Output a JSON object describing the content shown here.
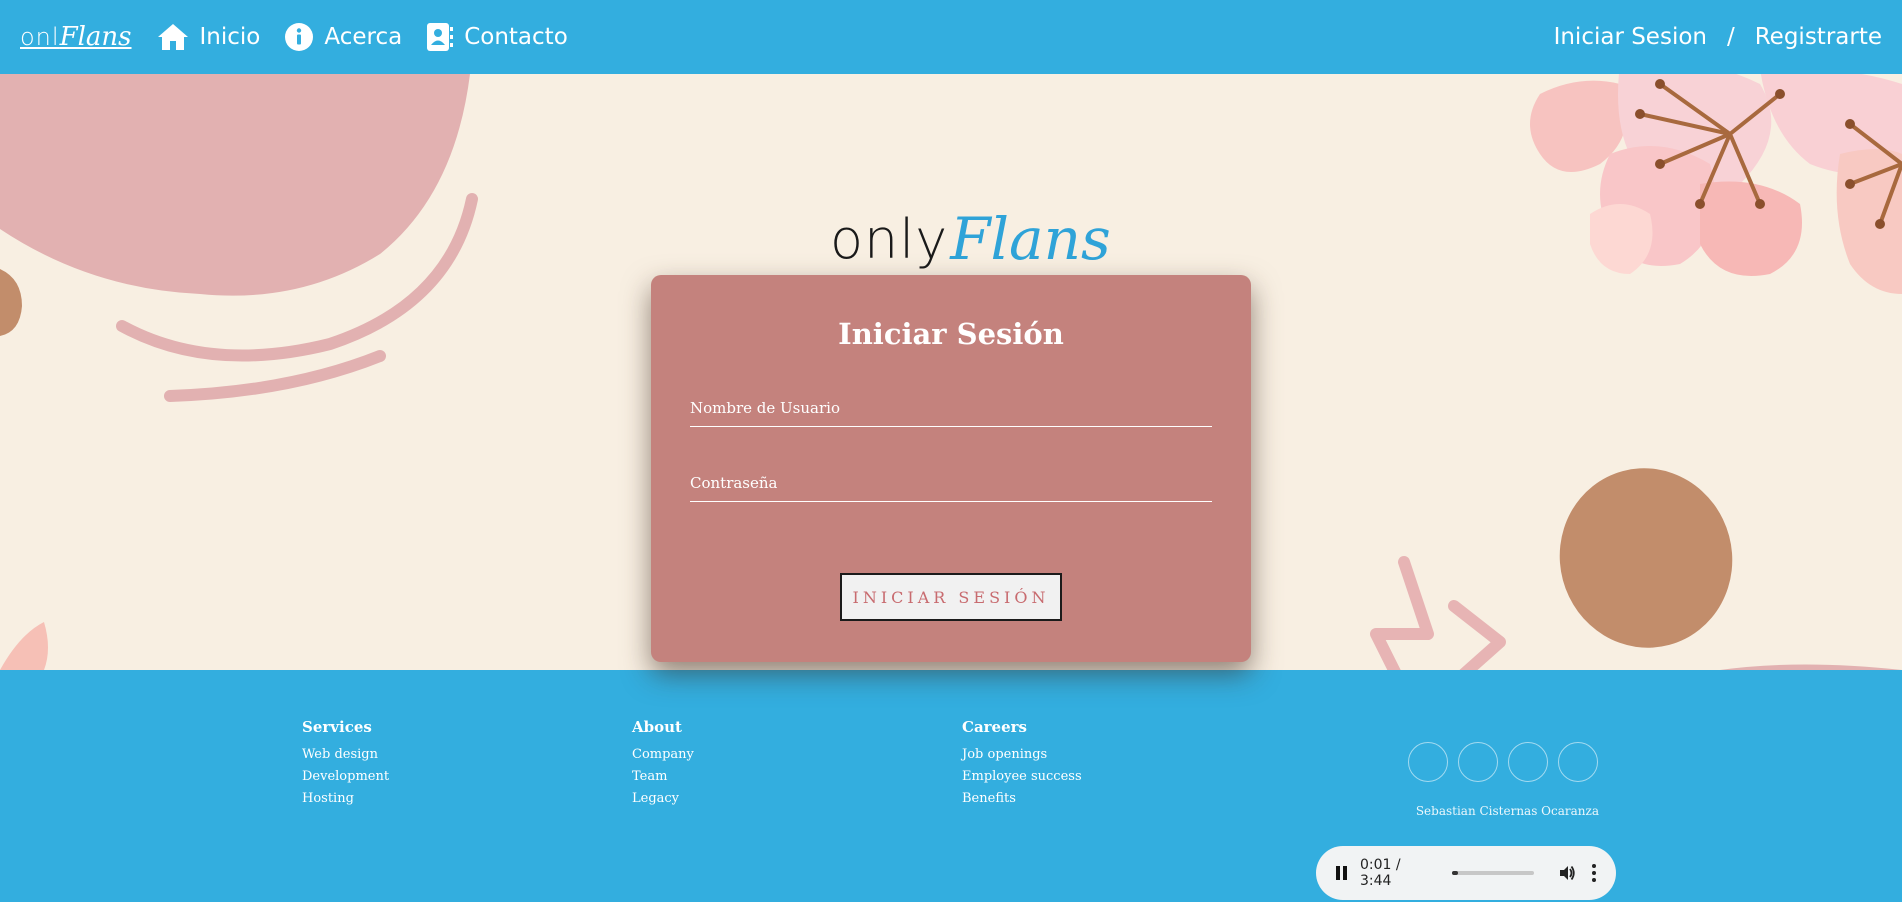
{
  "navbar": {
    "brand": {
      "only": "onl",
      "flans": "Flans"
    },
    "items": [
      {
        "label": "Inicio",
        "icon": "home-icon"
      },
      {
        "label": "Acerca",
        "icon": "info-icon"
      },
      {
        "label": "Contacto",
        "icon": "contact-book-icon"
      }
    ],
    "login_link": "Iniciar Sesion",
    "separator": "/",
    "register_link": "Registrarte"
  },
  "hero": {
    "logo": {
      "only": "only",
      "flans": "Flans"
    }
  },
  "login_form": {
    "title": "Iniciar Sesión",
    "username_label": "Nombre de Usuario",
    "username_value": "",
    "password_label": "Contraseña",
    "password_value": "",
    "submit_label": "INICIAR SESIÓN"
  },
  "footer": {
    "columns": [
      {
        "heading": "Services",
        "links": [
          "Web design",
          "Development",
          "Hosting"
        ]
      },
      {
        "heading": "About",
        "links": [
          "Company",
          "Team",
          "Legacy"
        ]
      },
      {
        "heading": "Careers",
        "links": [
          "Job openings",
          "Employee success",
          "Benefits"
        ]
      }
    ],
    "credit": "Sebastian Cisternas Ocaranza"
  },
  "audio_player": {
    "time": "0:01 / 3:44",
    "progress_fraction": 0.005,
    "volume_fraction": 1.0
  },
  "colors": {
    "primary_blue": "#33aedf",
    "background_cream": "#f8efe2",
    "card_rose": "#c4827d",
    "button_text": "#c86b6f"
  }
}
